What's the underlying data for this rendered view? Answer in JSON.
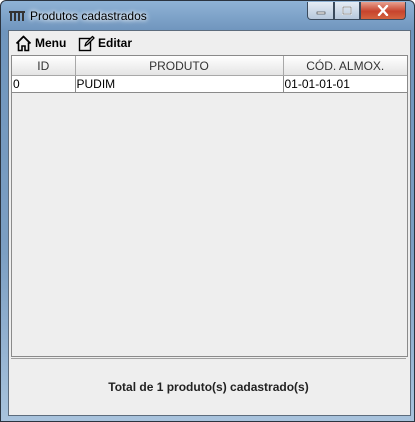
{
  "window": {
    "title": "Produtos cadastrados",
    "app_icon": "window-app-icon"
  },
  "toolbar": {
    "menu_label": "Menu",
    "menu_icon": "home-icon",
    "edit_label": "Editar",
    "edit_icon": "edit-icon"
  },
  "table": {
    "columns": [
      "ID",
      "PRODUTO",
      "CÓD. ALMOX."
    ],
    "rows": [
      [
        "0",
        "PUDIM",
        "01-01-01-01"
      ]
    ]
  },
  "footer": {
    "total_text": "Total de 1 produto(s) cadastrado(s)"
  },
  "colors": {
    "accent": "#6f95bd",
    "close": "#c7442d",
    "panel": "#eeeeee"
  }
}
